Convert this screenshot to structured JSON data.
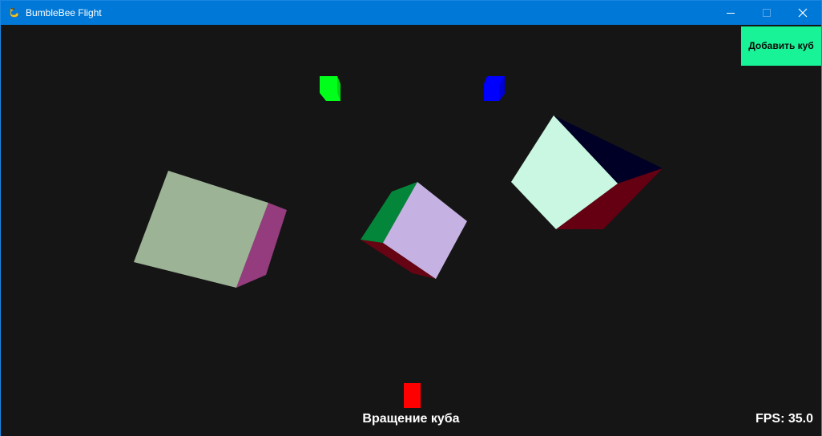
{
  "window": {
    "title": "BumbleBee Flight",
    "icon": "pygame-snake-icon",
    "controls": [
      "minimize-icon",
      "maximize-icon",
      "close-icon"
    ]
  },
  "toolbar": {
    "add_cube_label": "Добавить куб",
    "add_cube_color": "#19f397"
  },
  "scene": {
    "background_color": "#151515",
    "cubes": [
      {
        "name": "green-marker-cube",
        "colors": [
          "#00ff1a",
          "#00c414"
        ]
      },
      {
        "name": "blue-marker-cube",
        "colors": [
          "#0000ff",
          "#0000c8"
        ]
      },
      {
        "name": "olive-cube",
        "colors": [
          "#9db396",
          "#943c7d"
        ]
      },
      {
        "name": "lilac-cube",
        "colors": [
          "#c6b2e2",
          "#038639",
          "#670413"
        ]
      },
      {
        "name": "mint-cube",
        "colors": [
          "#c9f7e1",
          "#640012",
          "#000026"
        ]
      },
      {
        "name": "red-marker",
        "colors": [
          "#ff0000"
        ]
      }
    ]
  },
  "status": {
    "rotate_label": "Вращение куба",
    "fps_label": "FPS: 35.0"
  }
}
